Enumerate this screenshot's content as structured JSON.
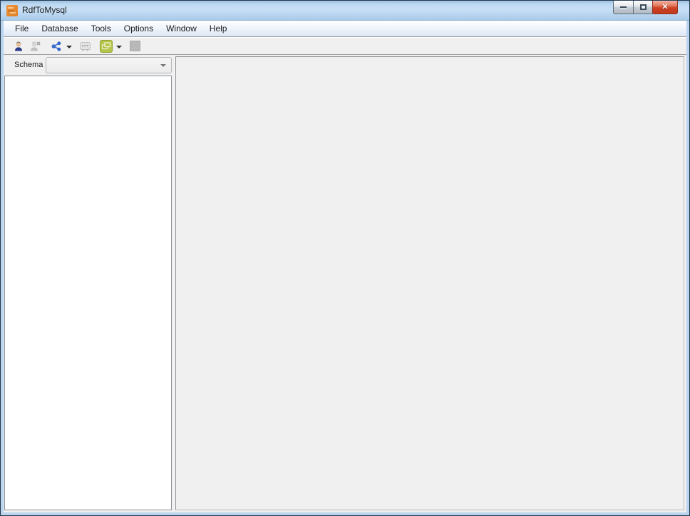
{
  "window": {
    "title": "RdfToMysql"
  },
  "menu": {
    "items": [
      {
        "label": "File"
      },
      {
        "label": "Database"
      },
      {
        "label": "Tools"
      },
      {
        "label": "Options"
      },
      {
        "label": "Window"
      },
      {
        "label": "Help"
      }
    ]
  },
  "toolbar": {
    "buttons": [
      {
        "icon": "user-icon",
        "enabled": true
      },
      {
        "icon": "user-disconnect-icon",
        "enabled": false
      },
      {
        "icon": "share-nodes-icon",
        "enabled": true,
        "has_dropdown": true
      },
      {
        "icon": "table-icon",
        "enabled": false
      },
      {
        "icon": "copy-window-icon",
        "enabled": true,
        "has_dropdown": true
      },
      {
        "icon": "square-icon",
        "enabled": false
      }
    ]
  },
  "sidebar": {
    "schema_label": "Schema",
    "schema_value": ""
  },
  "colors": {
    "titlebar_blue": "#b9d4ee",
    "frame_border": "#22384e",
    "close_red": "#ce4022",
    "app_icon_orange": "#e8862e",
    "toolbar_green": "#b5c44a",
    "share_icon_blue": "#2f63c8",
    "panel_gray": "#f0f0f0",
    "tree_white": "#ffffff"
  }
}
